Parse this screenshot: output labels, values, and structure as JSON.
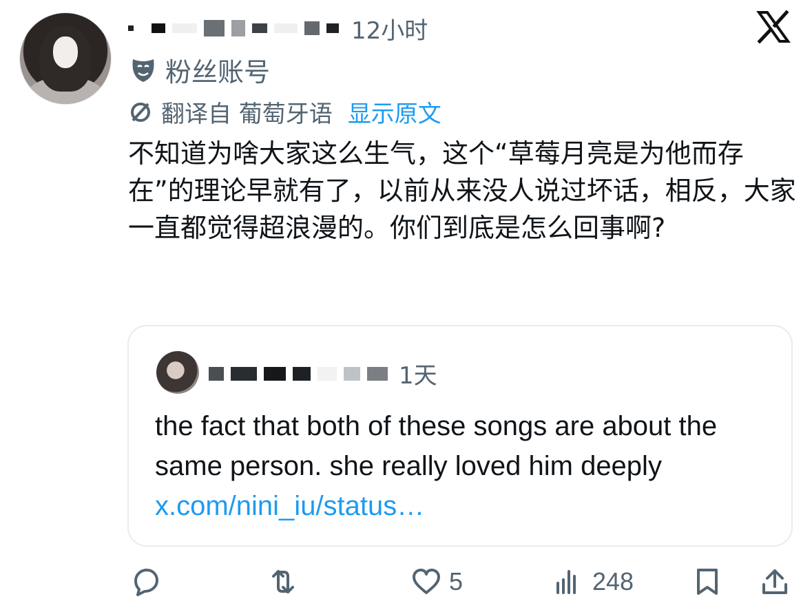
{
  "post": {
    "timestamp": "12小时",
    "account_badge": "粉丝账号",
    "translated_from": "翻译自 葡萄牙语",
    "show_original": "显示原文",
    "text": "不知道为啥大家这么生气，这个“草莓月亮是为他而存在”的理论早就有了，以前从来没人说过坏话，相反，大家一直都觉得超浪漫的。你们到底是怎么回事啊?"
  },
  "quote": {
    "timestamp": "1天",
    "text": "the fact that both of these songs are about the same person. she really loved him deeply ",
    "link": "x.com/nini_iu/status…"
  },
  "actions": {
    "likes": "5",
    "views": "248"
  },
  "colors": {
    "link_blue": "#1d9bf0",
    "muted_gray": "#536471",
    "border_gray": "#e8ecef"
  }
}
